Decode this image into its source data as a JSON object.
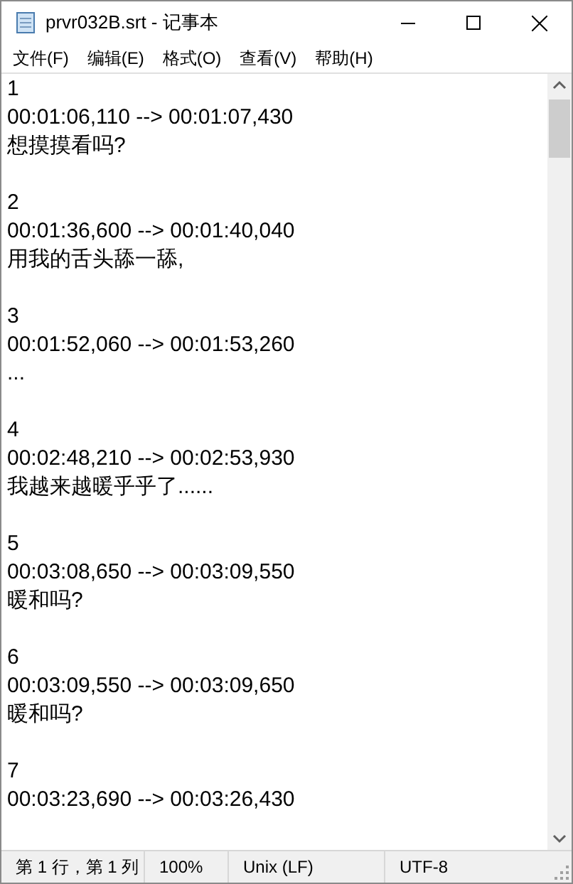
{
  "window": {
    "title": "prvr032B.srt - 记事本"
  },
  "menu": [
    "文件(F)",
    "编辑(E)",
    "格式(O)",
    "查看(V)",
    "帮助(H)"
  ],
  "entries": [
    {
      "index": "1",
      "timing": "00:01:06,110 --> 00:01:07,430",
      "text": "想摸摸看吗?"
    },
    {
      "index": "2",
      "timing": "00:01:36,600 --> 00:01:40,040",
      "text": "用我的舌头舔一舔,"
    },
    {
      "index": "3",
      "timing": "00:01:52,060 --> 00:01:53,260",
      "text": "..."
    },
    {
      "index": "4",
      "timing": "00:02:48,210 --> 00:02:53,930",
      "text": "我越来越暖乎乎了......"
    },
    {
      "index": "5",
      "timing": "00:03:08,650 --> 00:03:09,550",
      "text": "暖和吗?"
    },
    {
      "index": "6",
      "timing": "00:03:09,550 --> 00:03:09,650",
      "text": "暖和吗?"
    },
    {
      "index": "7",
      "timing": "00:03:23,690 --> 00:03:26,430"
    }
  ],
  "status_bar": [
    "第 1 行，第 1 列",
    "100%",
    "Unix (LF)",
    "UTF-8"
  ]
}
